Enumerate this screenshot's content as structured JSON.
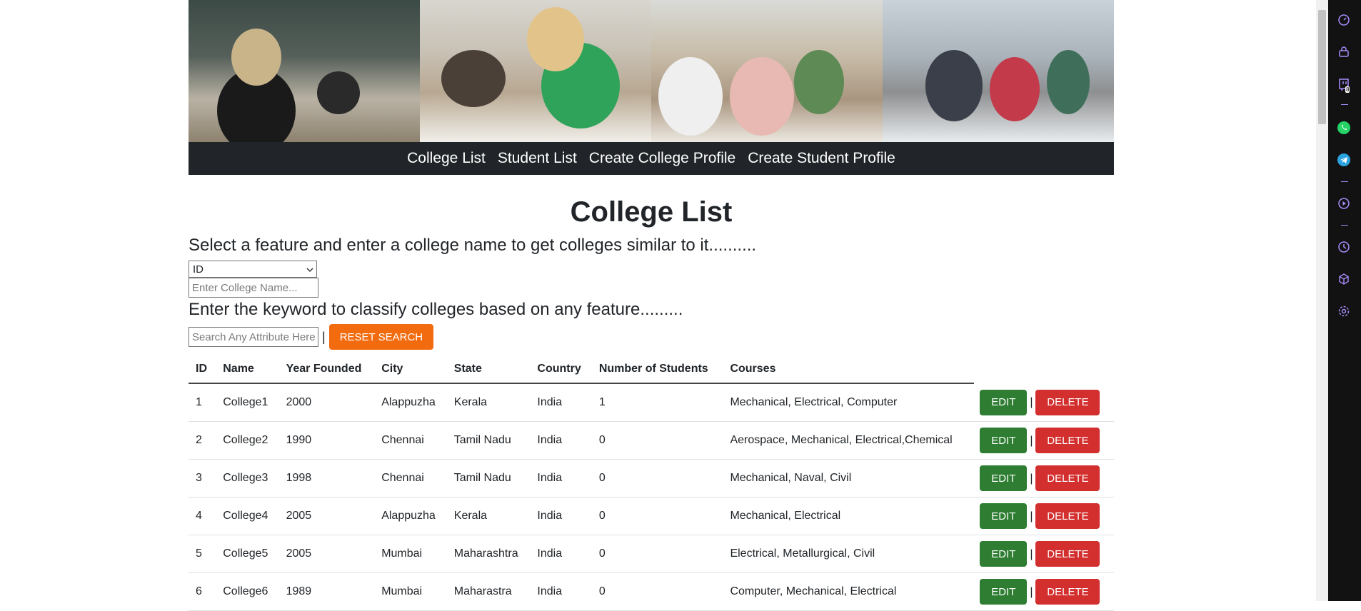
{
  "nav": {
    "links": [
      "College List",
      "Student List",
      "Create College Profile",
      "Create Student Profile"
    ]
  },
  "page_title": "College List",
  "similar": {
    "heading": "Select a feature and enter a college name to get colleges similar to it..........",
    "feature_selected": "ID",
    "college_placeholder": "Enter College Name..."
  },
  "classify": {
    "heading": "Enter the keyword to classify colleges based on any feature.........",
    "search_placeholder": "Search Any Attribute Here",
    "separator": "|",
    "reset_label": "RESET SEARCH"
  },
  "table": {
    "headers": [
      "ID",
      "Name",
      "Year Founded",
      "City",
      "State",
      "Country",
      "Number of Students",
      "Courses"
    ],
    "edit_label": "EDIT",
    "delete_label": "DELETE",
    "pipe": "|",
    "rows": [
      [
        "1",
        "College1",
        "2000",
        "Alappuzha",
        "Kerala",
        "India",
        "1",
        "Mechanical, Electrical, Computer"
      ],
      [
        "2",
        "College2",
        "1990",
        "Chennai",
        "Tamil Nadu",
        "India",
        "0",
        "Aerospace, Mechanical, Electrical,Chemical"
      ],
      [
        "3",
        "College3",
        "1998",
        "Chennai",
        "Tamil Nadu",
        "India",
        "0",
        "Mechanical, Naval, Civil"
      ],
      [
        "4",
        "College4",
        "2005",
        "Alappuzha",
        "Kerala",
        "India",
        "0",
        "Mechanical, Electrical"
      ],
      [
        "5",
        "College5",
        "2005",
        "Mumbai",
        "Maharashtra",
        "India",
        "0",
        "Electrical, Metallurgical, Civil"
      ],
      [
        "6",
        "College6",
        "1989",
        "Mumbai",
        "Maharastra",
        "India",
        "0",
        "Computer, Mechanical, Electrical"
      ]
    ]
  },
  "side_panel": {
    "icons": [
      "speedometer-icon",
      "bag-icon",
      "twitch-icon",
      "whatsapp-icon",
      "telegram-icon",
      "play-icon",
      "clock-icon",
      "cube-icon",
      "settings-icon"
    ],
    "badge": "8"
  },
  "colors": {
    "navbar": "#212529",
    "reset": "#f26b0f",
    "edit": "#2e7d32",
    "delete": "#d32f2f",
    "side_panel": "#121212",
    "side_icon": "#a78bfa"
  }
}
